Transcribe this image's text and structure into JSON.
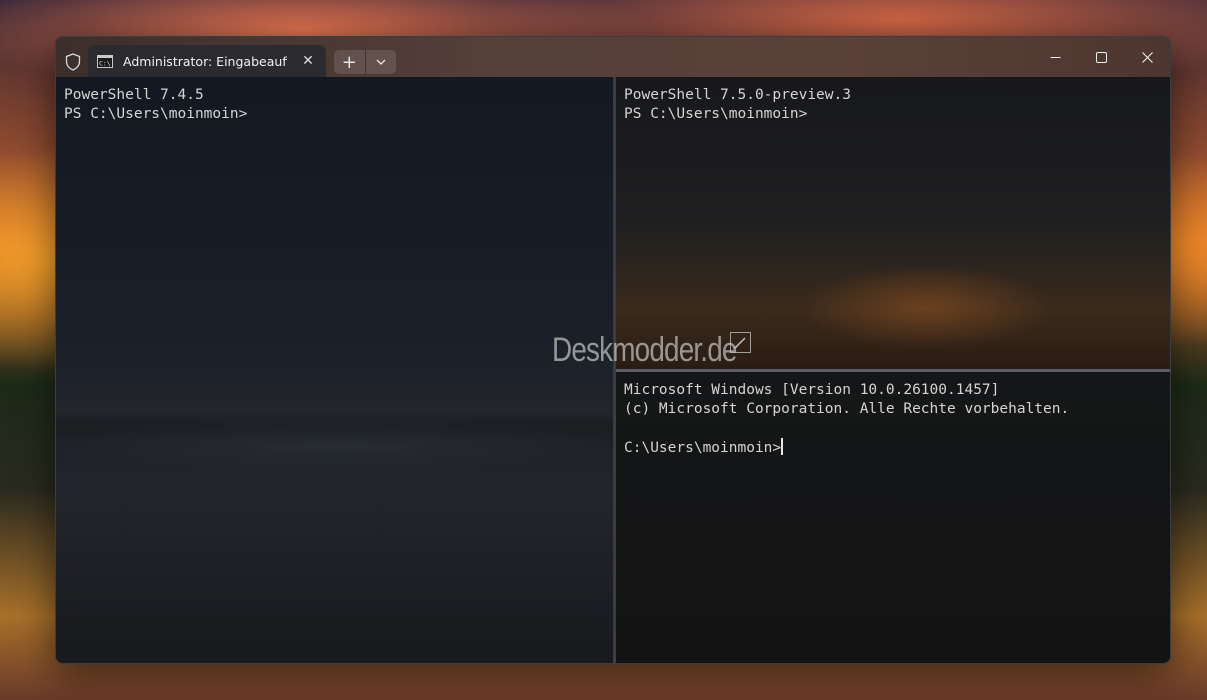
{
  "window": {
    "tab_title": "Administrator: Eingabeaufforderung",
    "icons": {
      "shield": "shield-icon",
      "tab": "command-prompt-icon",
      "close_tab": "close-icon",
      "new_tab": "plus-icon",
      "dropdown": "chevron-down-icon",
      "minimize": "minimize-icon",
      "maximize": "maximize-icon",
      "close": "close-icon"
    },
    "tab_close_glyph": "✕",
    "new_tab_glyph": "+"
  },
  "panes": {
    "left": {
      "lines": [
        "PowerShell 7.4.5",
        "PS C:\\Users\\moinmoin>"
      ]
    },
    "top_right": {
      "lines": [
        "PowerShell 7.5.0-preview.3",
        "PS C:\\Users\\moinmoin>"
      ]
    },
    "bottom_right": {
      "lines": [
        "Microsoft Windows [Version 10.0.26100.1457]",
        "(c) Microsoft Corporation. Alle Rechte vorbehalten.",
        "",
        "C:\\Users\\moinmoin>"
      ]
    }
  },
  "watermark": {
    "text": "Deskmodder.de"
  },
  "colors": {
    "terminal_text": "#d4d4d4",
    "tab_bg": "#2b2a2e",
    "divider": "#3a3d43"
  }
}
